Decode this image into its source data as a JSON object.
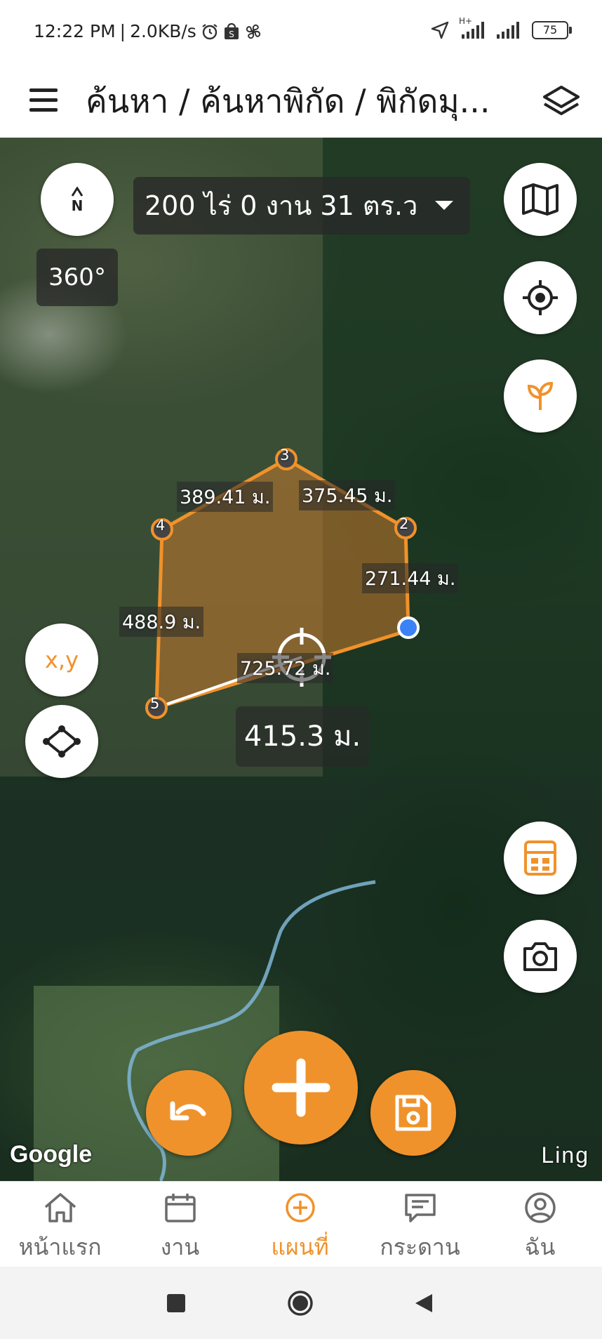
{
  "status_bar": {
    "time": "12:22 PM",
    "net_speed": "2.0KB/s",
    "network_type": "H+",
    "battery": "75",
    "icons": [
      "alarm-icon",
      "shop-icon",
      "fan-icon",
      "location-arrow-icon",
      "signal-icon",
      "battery-icon"
    ]
  },
  "header": {
    "title": "ค้นหา / ค้นหาพิกัด / พิกัดมุ...",
    "icons": [
      "menu-icon",
      "layers-icon"
    ]
  },
  "map": {
    "area_label": "200 ไร่ 0 งาน 31 ตร.ว",
    "compass_label": "N",
    "heading": "360°",
    "xy_button": "x,y",
    "edge_labels": [
      "389.41 ม.",
      "375.45 ม.",
      "271.44 ม.",
      "488.9 ม.",
      "725.72 ม."
    ],
    "vertex_labels": [
      "2",
      "3",
      "4",
      "5"
    ],
    "current_distance": "415.3 ม.",
    "attribution_left": "Google",
    "attribution_right": "Ling",
    "colors": {
      "accent": "#f0922b",
      "polygon_fill": "#c67a2e",
      "gps_dot": "#3b82f6"
    }
  },
  "bottom_nav": {
    "items": [
      {
        "label": "หน้าแรก",
        "icon": "home-icon"
      },
      {
        "label": "งาน",
        "icon": "calendar-icon"
      },
      {
        "label": "แผนที่",
        "icon": "plus-circle-icon",
        "active": true
      },
      {
        "label": "กระดาน",
        "icon": "board-icon"
      },
      {
        "label": "ฉัน",
        "icon": "user-icon"
      }
    ]
  }
}
